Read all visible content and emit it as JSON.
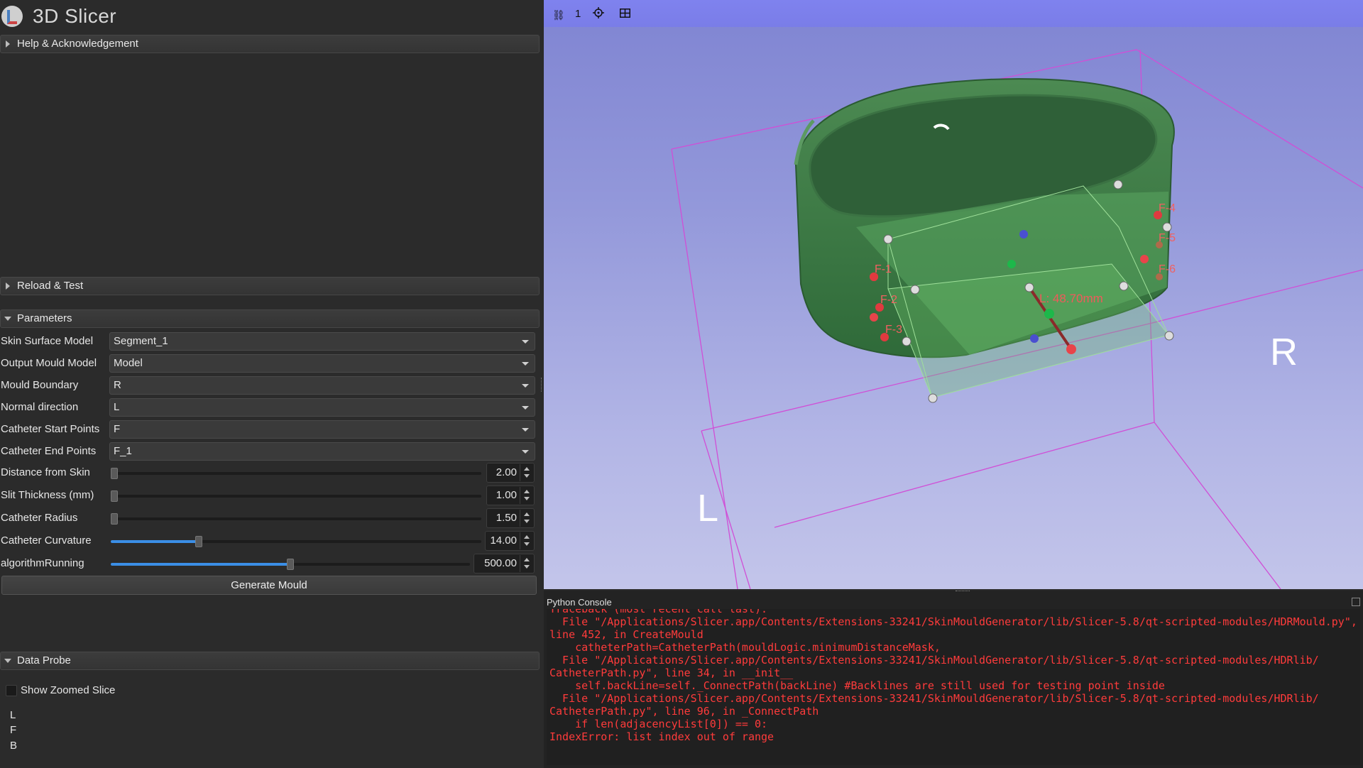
{
  "app": {
    "title": "3D Slicer",
    "logo_icon": "slicer-logo-icon"
  },
  "sections": {
    "help": "Help & Acknowledgement",
    "reload": "Reload & Test",
    "parameters": "Parameters",
    "data_probe": "Data Probe"
  },
  "parameters": {
    "skin_surface_model": {
      "label": "Skin Surface Model",
      "value": "Segment_1"
    },
    "output_mould_model": {
      "label": "Output Mould Model",
      "value": "Model"
    },
    "mould_boundary": {
      "label": "Mould Boundary",
      "value": "R"
    },
    "normal_direction": {
      "label": "Normal direction",
      "value": "L"
    },
    "catheter_start_points": {
      "label": "Catheter Start Points",
      "value": "F"
    },
    "catheter_end_points": {
      "label": "Catheter End Points",
      "value": "F_1"
    },
    "distance_from_skin": {
      "label": "Distance from Skin",
      "value": "2.00"
    },
    "slit_thickness": {
      "label": "Slit Thickness (mm)",
      "value": "1.00"
    },
    "catheter_radius": {
      "label": "Catheter Radius",
      "value": "1.50"
    },
    "catheter_curvature": {
      "label": "Catheter Curvature",
      "value": "14.00"
    },
    "algorithm_running": {
      "label": "algorithmRunning",
      "value": "500.00"
    },
    "generate_button": "Generate Mould"
  },
  "data_probe": {
    "show_zoomed_slice": "Show Zoomed Slice",
    "lines": [
      "L",
      "F",
      "B"
    ]
  },
  "view": {
    "view_number": "1",
    "orientation_left": "L",
    "orientation_right": "R",
    "measurement": "L: 48.70mm",
    "markup_labels": [
      "F-1",
      "F-2",
      "F-3",
      "F-4",
      "F-5",
      "F-6"
    ],
    "background_top": "#7f84d2",
    "background_bottom": "#c3c5ea",
    "model_color": "#3f7c45",
    "roi_box_color": "#d04fd6"
  },
  "console": {
    "title": "Python Console",
    "lines": [
      "Traceback (most recent call last):",
      "  File \"/Applications/Slicer.app/Contents/Extensions-33241/SkinMouldGenerator/lib/Slicer-5.8/qt-scripted-modules/HDRMould.py\",",
      "line 452, in CreateMould",
      "    catheterPath=CatheterPath(mouldLogic.minimumDistanceMask,",
      "  File \"/Applications/Slicer.app/Contents/Extensions-33241/SkinMouldGenerator/lib/Slicer-5.8/qt-scripted-modules/HDRlib/",
      "CatheterPath.py\", line 34, in __init__",
      "    self.backLine=self._ConnectPath(backLine) #Backlines are still used for testing point inside",
      "  File \"/Applications/Slicer.app/Contents/Extensions-33241/SkinMouldGenerator/lib/Slicer-5.8/qt-scripted-modules/HDRlib/",
      "CatheterPath.py\", line 96, in _ConnectPath",
      "    if len(adjacencyList[0]) == 0:",
      "IndexError: list index out of range"
    ],
    "error_color": "#ff3b3b"
  }
}
